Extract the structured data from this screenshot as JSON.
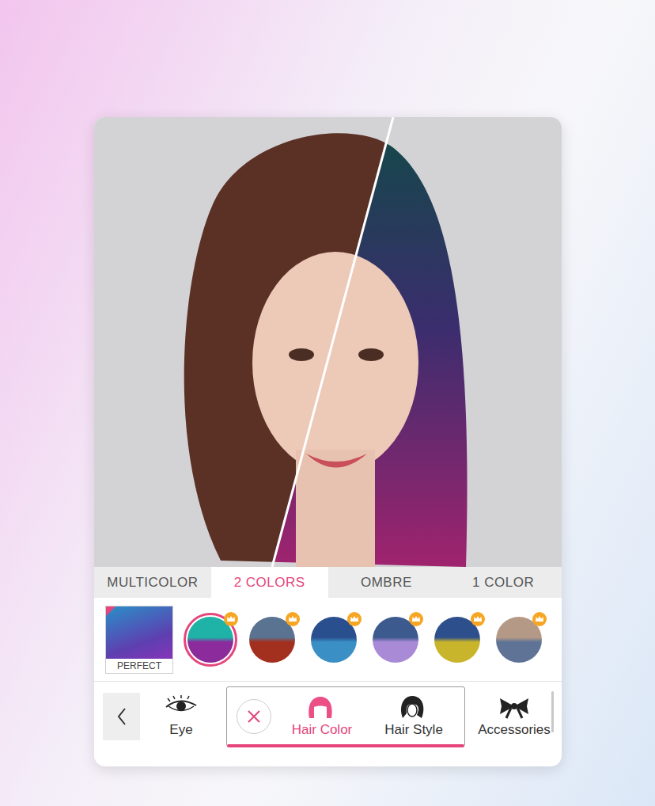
{
  "tabs": [
    {
      "label": "MULTICOLOR",
      "selected": false
    },
    {
      "label": "2 COLORS",
      "selected": true
    },
    {
      "label": "OMBRE",
      "selected": false
    },
    {
      "label": "1 COLOR",
      "selected": false
    }
  ],
  "featured": {
    "label": "PERFECT"
  },
  "swatches": [
    {
      "selected": true,
      "premium": true,
      "colors": [
        "#1fb3a8",
        "#8b2b9c"
      ]
    },
    {
      "selected": false,
      "premium": true,
      "colors": [
        "#5a7390",
        "#a3301f"
      ]
    },
    {
      "selected": false,
      "premium": true,
      "colors": [
        "#2a4f8f",
        "#3a8fc4"
      ]
    },
    {
      "selected": false,
      "premium": true,
      "colors": [
        "#3d5a8e",
        "#a98ad6"
      ]
    },
    {
      "selected": false,
      "premium": true,
      "colors": [
        "#2d4f8c",
        "#c9b52c"
      ]
    },
    {
      "selected": false,
      "premium": true,
      "colors": [
        "#b49a86",
        "#5f7396"
      ]
    }
  ],
  "toolbar": [
    {
      "label": "Eye",
      "selected": false,
      "kind": "eye"
    },
    {
      "label": "Hair Color",
      "selected": true,
      "kind": "haircolor"
    },
    {
      "label": "Hair Style",
      "selected": false,
      "kind": "hairstyle"
    },
    {
      "label": "Accessories",
      "selected": false,
      "kind": "bow"
    }
  ]
}
